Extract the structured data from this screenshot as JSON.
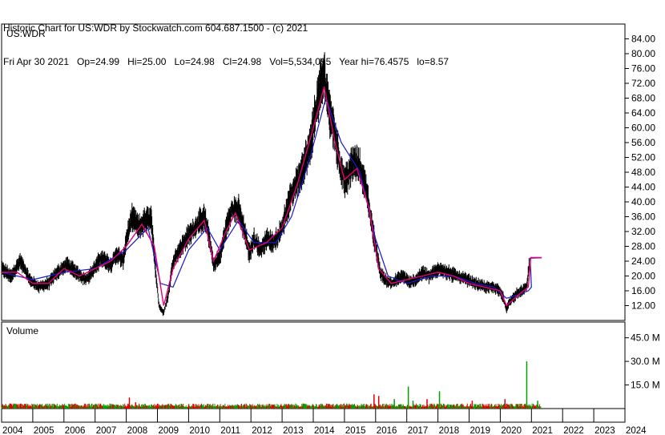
{
  "header": {
    "line1": "Historic Chart for US:WDR by Stockwatch.com 604.687.1500 - (c) 2021",
    "line2": "Fri Apr 30 2021   Op=24.99   Hi=25.00   Lo=24.98   Cl=24.98   Vol=5,534,095   Year hi=76.4575   lo=8.57"
  },
  "chart_data": [
    {
      "type": "line",
      "title": "US:WDR",
      "xlim": [
        2004.0,
        2024.0
      ],
      "ylim": [
        8.0,
        88.0
      ],
      "y_ticks": [
        12,
        16,
        20,
        24,
        28,
        32,
        36,
        40,
        44,
        48,
        52,
        56,
        60,
        64,
        68,
        72,
        76,
        80,
        84
      ],
      "y_tick_labels": [
        "12.00",
        "16.00",
        "20.00",
        "24.00",
        "28.00",
        "32.00",
        "36.00",
        "40.00",
        "44.00",
        "48.00",
        "52.00",
        "56.00",
        "60.00",
        "64.00",
        "68.00",
        "72.00",
        "76.00",
        "80.00",
        "84.00"
      ],
      "x_tick_labels": [
        "2004",
        "2005",
        "2006",
        "2007",
        "2008",
        "2009",
        "2010",
        "2011",
        "2012",
        "2013",
        "2014",
        "2015",
        "2016",
        "2017",
        "2018",
        "2019",
        "2020",
        "2021",
        "2022",
        "2023",
        "2024"
      ],
      "grid": false,
      "colors": {
        "price": "#000000",
        "short_ma": "#e8007a",
        "long_ma": "#1a1acc"
      },
      "price_path": [
        [
          2004.0,
          22
        ],
        [
          2004.3,
          20
        ],
        [
          2004.6,
          24
        ],
        [
          2004.9,
          19
        ],
        [
          2005.2,
          17
        ],
        [
          2005.5,
          18
        ],
        [
          2005.8,
          21
        ],
        [
          2006.1,
          23
        ],
        [
          2006.4,
          21
        ],
        [
          2006.7,
          19
        ],
        [
          2006.9,
          21
        ],
        [
          2007.2,
          25
        ],
        [
          2007.5,
          23
        ],
        [
          2007.7,
          26
        ],
        [
          2007.9,
          24
        ],
        [
          2008.0,
          30
        ],
        [
          2008.2,
          36
        ],
        [
          2008.4,
          33
        ],
        [
          2008.6,
          35
        ],
        [
          2008.8,
          36
        ],
        [
          2008.9,
          25
        ],
        [
          2009.05,
          12
        ],
        [
          2009.2,
          10
        ],
        [
          2009.35,
          15
        ],
        [
          2009.5,
          24
        ],
        [
          2009.7,
          27
        ],
        [
          2010.0,
          31
        ],
        [
          2010.3,
          34
        ],
        [
          2010.5,
          36
        ],
        [
          2010.65,
          31
        ],
        [
          2010.8,
          23
        ],
        [
          2011.0,
          25
        ],
        [
          2011.2,
          33
        ],
        [
          2011.4,
          38
        ],
        [
          2011.6,
          38
        ],
        [
          2011.8,
          32
        ],
        [
          2011.95,
          26
        ],
        [
          2012.1,
          30
        ],
        [
          2012.3,
          27
        ],
        [
          2012.5,
          30
        ],
        [
          2012.7,
          29
        ],
        [
          2012.9,
          31
        ],
        [
          2013.1,
          36
        ],
        [
          2013.3,
          42
        ],
        [
          2013.5,
          46
        ],
        [
          2013.7,
          50
        ],
        [
          2013.9,
          55
        ],
        [
          2014.05,
          63
        ],
        [
          2014.2,
          70
        ],
        [
          2014.35,
          74
        ],
        [
          2014.5,
          66
        ],
        [
          2014.7,
          58
        ],
        [
          2014.85,
          50
        ],
        [
          2015.0,
          46
        ],
        [
          2015.15,
          48
        ],
        [
          2015.3,
          51
        ],
        [
          2015.5,
          49
        ],
        [
          2015.7,
          44
        ],
        [
          2015.85,
          35
        ],
        [
          2016.0,
          28
        ],
        [
          2016.15,
          21
        ],
        [
          2016.3,
          19
        ],
        [
          2016.5,
          18
        ],
        [
          2016.7,
          19
        ],
        [
          2016.9,
          20
        ],
        [
          2017.1,
          18
        ],
        [
          2017.3,
          19
        ],
        [
          2017.5,
          21
        ],
        [
          2017.7,
          20
        ],
        [
          2017.9,
          21
        ],
        [
          2018.1,
          22
        ],
        [
          2018.3,
          21
        ],
        [
          2018.6,
          20
        ],
        [
          2018.9,
          19
        ],
        [
          2019.2,
          18
        ],
        [
          2019.5,
          17
        ],
        [
          2019.8,
          17
        ],
        [
          2020.0,
          16
        ],
        [
          2020.1,
          14
        ],
        [
          2020.2,
          11
        ],
        [
          2020.3,
          13
        ],
        [
          2020.5,
          15
        ],
        [
          2020.7,
          16
        ],
        [
          2020.85,
          17
        ],
        [
          2020.95,
          25
        ],
        [
          2021.1,
          24.99
        ],
        [
          2021.33,
          24.98
        ]
      ],
      "short_ma_path": [
        [
          2004.0,
          21
        ],
        [
          2004.5,
          21
        ],
        [
          2005.0,
          18
        ],
        [
          2005.5,
          18
        ],
        [
          2006.0,
          22
        ],
        [
          2006.5,
          20
        ],
        [
          2007.0,
          22
        ],
        [
          2007.5,
          24
        ],
        [
          2008.0,
          28
        ],
        [
          2008.5,
          34
        ],
        [
          2008.9,
          28
        ],
        [
          2009.2,
          12
        ],
        [
          2009.5,
          22
        ],
        [
          2010.0,
          30
        ],
        [
          2010.5,
          35
        ],
        [
          2010.8,
          24
        ],
        [
          2011.2,
          32
        ],
        [
          2011.5,
          37
        ],
        [
          2011.95,
          27
        ],
        [
          2012.5,
          29
        ],
        [
          2013.0,
          33
        ],
        [
          2013.5,
          45
        ],
        [
          2014.0,
          60
        ],
        [
          2014.35,
          71
        ],
        [
          2014.7,
          56
        ],
        [
          2015.0,
          46
        ],
        [
          2015.4,
          49
        ],
        [
          2015.8,
          38
        ],
        [
          2016.1,
          22
        ],
        [
          2016.5,
          18
        ],
        [
          2017.0,
          19
        ],
        [
          2017.5,
          20
        ],
        [
          2018.0,
          21
        ],
        [
          2018.5,
          20
        ],
        [
          2019.0,
          18
        ],
        [
          2019.5,
          17
        ],
        [
          2020.0,
          16
        ],
        [
          2020.2,
          12
        ],
        [
          2020.6,
          15
        ],
        [
          2020.9,
          17
        ],
        [
          2020.98,
          25
        ],
        [
          2021.33,
          24.98
        ]
      ],
      "long_ma_path": [
        [
          2004.0,
          21
        ],
        [
          2005.0,
          19
        ],
        [
          2006.0,
          21
        ],
        [
          2007.0,
          22
        ],
        [
          2008.0,
          27
        ],
        [
          2008.7,
          33
        ],
        [
          2009.1,
          18
        ],
        [
          2009.5,
          17
        ],
        [
          2010.0,
          27
        ],
        [
          2010.6,
          33
        ],
        [
          2011.0,
          27
        ],
        [
          2011.6,
          35
        ],
        [
          2012.1,
          29
        ],
        [
          2012.8,
          29
        ],
        [
          2013.3,
          36
        ],
        [
          2013.9,
          52
        ],
        [
          2014.4,
          68
        ],
        [
          2014.9,
          56
        ],
        [
          2015.5,
          48
        ],
        [
          2016.0,
          30
        ],
        [
          2016.4,
          20
        ],
        [
          2017.0,
          18
        ],
        [
          2017.8,
          20
        ],
        [
          2018.5,
          20
        ],
        [
          2019.2,
          18
        ],
        [
          2019.8,
          17
        ],
        [
          2020.2,
          14
        ],
        [
          2020.6,
          15
        ],
        [
          2020.9,
          16
        ],
        [
          2021.0,
          17
        ],
        [
          2020.96,
          24.8
        ],
        [
          2021.33,
          24.9
        ]
      ]
    },
    {
      "type": "bar",
      "title": "Volume",
      "ylim": [
        0,
        55
      ],
      "y_ticks": [
        15,
        30,
        45
      ],
      "y_tick_labels": [
        "15.0 M",
        "30.0 M",
        "45.0 M"
      ],
      "colors": {
        "up": "#00a000",
        "down": "#dd0000"
      },
      "spikes": [
        {
          "x": 2008.1,
          "v": 7,
          "dir": "down"
        },
        {
          "x": 2008.3,
          "v": 4,
          "dir": "down"
        },
        {
          "x": 2015.95,
          "v": 9,
          "dir": "down"
        },
        {
          "x": 2016.1,
          "v": 8,
          "dir": "down"
        },
        {
          "x": 2016.6,
          "v": 6,
          "dir": "up"
        },
        {
          "x": 2017.05,
          "v": 14,
          "dir": "up"
        },
        {
          "x": 2017.2,
          "v": 5,
          "dir": "up"
        },
        {
          "x": 2017.65,
          "v": 6,
          "dir": "down"
        },
        {
          "x": 2018.05,
          "v": 11,
          "dir": "up"
        },
        {
          "x": 2019.1,
          "v": 5,
          "dir": "down"
        },
        {
          "x": 2020.15,
          "v": 6,
          "dir": "down"
        },
        {
          "x": 2020.85,
          "v": 30,
          "dir": "up"
        },
        {
          "x": 2021.2,
          "v": 5,
          "dir": "up"
        }
      ],
      "baseline_level": 2.5
    }
  ]
}
